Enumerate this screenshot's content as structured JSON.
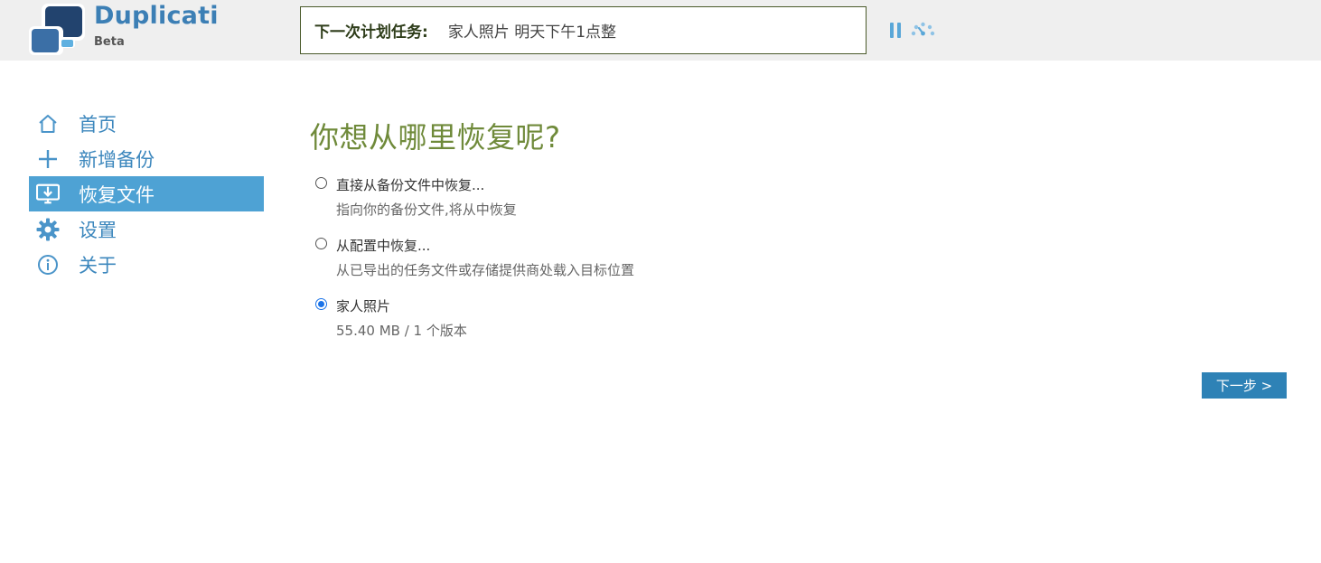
{
  "header": {
    "brand_name": "Duplicati",
    "brand_sub": "Beta",
    "next_task_label": "下一次计划任务:",
    "next_task_value": "家人照片 明天下午1点整",
    "pause_icon": "pause-icon",
    "throttle_icon": "throttle-gauge-icon"
  },
  "sidebar": {
    "items": [
      {
        "label": "首页",
        "icon": "home-icon",
        "active": false
      },
      {
        "label": "新增备份",
        "icon": "plus-icon",
        "active": false
      },
      {
        "label": "恢复文件",
        "icon": "restore-monitor-icon",
        "active": true
      },
      {
        "label": "设置",
        "icon": "gear-icon",
        "active": false
      },
      {
        "label": "关于",
        "icon": "info-icon",
        "active": false
      }
    ]
  },
  "main": {
    "title": "你想从哪里恢复呢?",
    "options": [
      {
        "title": "直接从备份文件中恢复...",
        "subtitle": "指向你的备份文件,将从中恢复",
        "selected": false
      },
      {
        "title": "从配置中恢复...",
        "subtitle": "从已导出的任务文件或存储提供商处载入目标位置",
        "selected": false
      },
      {
        "title": "家人照片",
        "subtitle": "55.40 MB / 1 个版本",
        "selected": true
      }
    ],
    "next_button": "下一步 >"
  },
  "colors": {
    "accent": "#4ea2d4",
    "brand": "#3c7fb5",
    "title_green": "#6f8a3a",
    "button": "#2e82b6"
  }
}
